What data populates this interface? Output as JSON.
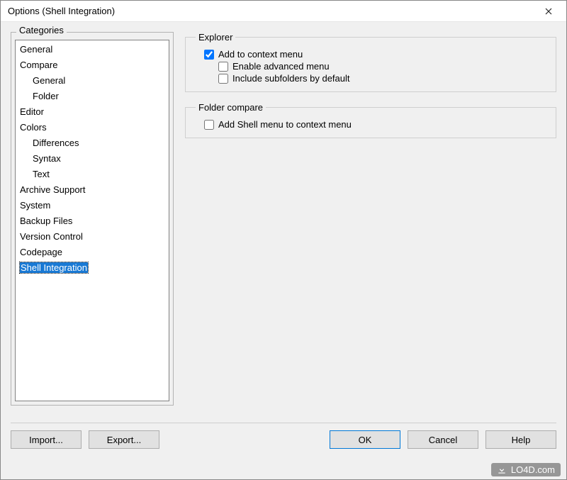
{
  "window": {
    "title": "Options (Shell Integration)"
  },
  "categories": {
    "label": "Categories",
    "items": [
      {
        "label": "General",
        "indent": 0,
        "selected": false
      },
      {
        "label": "Compare",
        "indent": 0,
        "selected": false
      },
      {
        "label": "General",
        "indent": 1,
        "selected": false
      },
      {
        "label": "Folder",
        "indent": 1,
        "selected": false
      },
      {
        "label": "Editor",
        "indent": 0,
        "selected": false
      },
      {
        "label": "Colors",
        "indent": 0,
        "selected": false
      },
      {
        "label": "Differences",
        "indent": 1,
        "selected": false
      },
      {
        "label": "Syntax",
        "indent": 1,
        "selected": false
      },
      {
        "label": "Text",
        "indent": 1,
        "selected": false
      },
      {
        "label": "Archive Support",
        "indent": 0,
        "selected": false
      },
      {
        "label": "System",
        "indent": 0,
        "selected": false
      },
      {
        "label": "Backup Files",
        "indent": 0,
        "selected": false
      },
      {
        "label": "Version Control",
        "indent": 0,
        "selected": false
      },
      {
        "label": "Codepage",
        "indent": 0,
        "selected": false
      },
      {
        "label": "Shell Integration",
        "indent": 0,
        "selected": true
      }
    ]
  },
  "explorer": {
    "legend": "Explorer",
    "add_context_menu": {
      "label": "Add to context menu",
      "checked": true
    },
    "enable_advanced": {
      "label": "Enable advanced menu",
      "checked": false
    },
    "include_subfolders": {
      "label": "Include subfolders by default",
      "checked": false
    }
  },
  "folder_compare": {
    "legend": "Folder compare",
    "add_shell_menu": {
      "label": "Add Shell menu to context menu",
      "checked": false
    }
  },
  "buttons": {
    "import": "Import...",
    "export": "Export...",
    "ok": "OK",
    "cancel": "Cancel",
    "help": "Help"
  },
  "watermark": "LO4D.com"
}
